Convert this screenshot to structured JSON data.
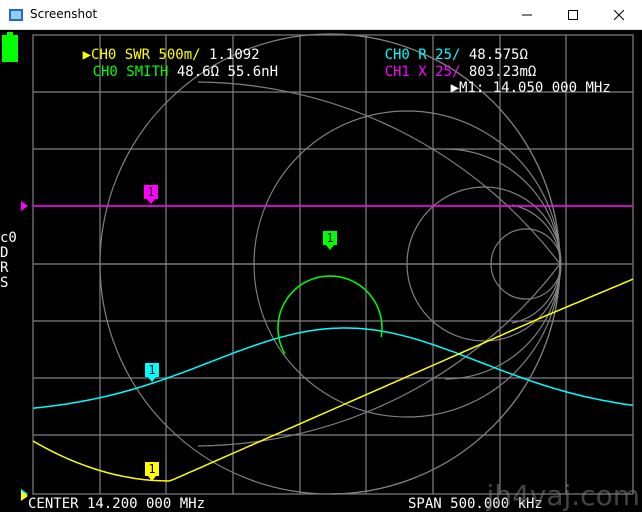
{
  "window": {
    "title": "Screenshot",
    "controls": {
      "minimize": "minimize-icon",
      "maximize": "maximize-icon",
      "close": "close-icon"
    }
  },
  "header": {
    "ch0_swr_label": "CH0 SWR 500m/",
    "ch0_swr_value": "1.1092",
    "ch0_smith_label": "CH0 SMITH",
    "ch0_smith_value": "48.6Ω 55.6nH",
    "ch0_r_label": "CH0 R 25/",
    "ch0_r_value": "48.575Ω",
    "ch1_x_label": "CH1 X 25/",
    "ch1_x_value": "803.23mΩ",
    "marker_readout": "M1: 14.050 000 MHz"
  },
  "sidebar": {
    "lines": [
      "c0",
      "D",
      "R",
      "S"
    ]
  },
  "footer": {
    "center": "CENTER 14.200 000 MHz",
    "span": "SPAN 500.000 kHz"
  },
  "marker_label": "1",
  "watermark": "jh4vaj.com",
  "colors": {
    "swr": "#ffff00",
    "resistance": "#00ffff",
    "reactance": "#ff00ff",
    "smith": "#00ff00",
    "grid": "#808080"
  }
}
